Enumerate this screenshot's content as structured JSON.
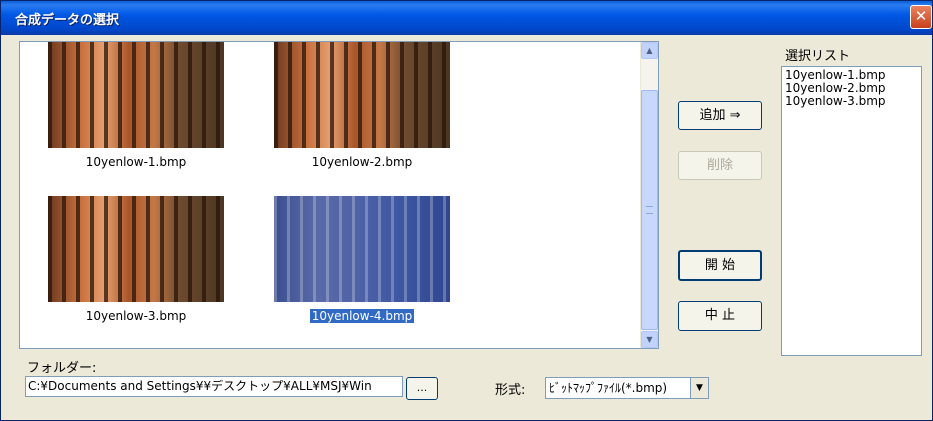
{
  "window": {
    "title": "合成データの選択",
    "close_icon": "close-icon"
  },
  "thumbnails": [
    {
      "caption": "10yenlow-1.bmp",
      "selected": false
    },
    {
      "caption": "10yenlow-2.bmp",
      "selected": false
    },
    {
      "caption": "10yenlow-3.bmp",
      "selected": false
    },
    {
      "caption": "10yenlow-4.bmp",
      "selected": true
    }
  ],
  "buttons": {
    "add": "追加 ⇒",
    "remove": "削除",
    "start": "開 始",
    "stop": "中 止",
    "browse": "..."
  },
  "selection_list": {
    "label": "選択リスト",
    "items": [
      "10yenlow-1.bmp",
      "10yenlow-2.bmp",
      "10yenlow-3.bmp"
    ]
  },
  "folder": {
    "label": "フォルダー:",
    "value": "C:¥Documents and Settings¥¥デスクトップ¥ALL¥MSJ¥Win"
  },
  "format": {
    "label": "形式:",
    "value": "ﾋﾞｯﾄﾏｯﾌﾟﾌｧｲﾙ(*.bmp)"
  },
  "colors": {
    "title_bar": "#0055e5",
    "selection": "#316ac5",
    "face": "#ece9d8"
  }
}
